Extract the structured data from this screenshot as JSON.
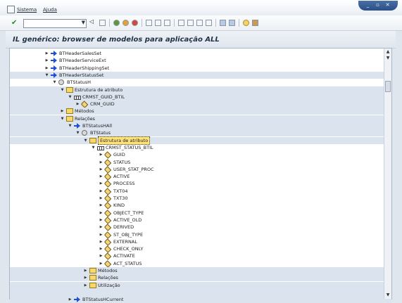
{
  "menu": {
    "items": [
      "Sistema",
      "Ajuda"
    ]
  },
  "toolbar": {
    "command_value": ""
  },
  "page": {
    "title": "IL genérico: browser de modelos para aplicação ALL"
  },
  "tree": {
    "rows": [
      {
        "label": "BTHeaderSalesSet",
        "depth": 0,
        "toggle": "collapsed",
        "icon": "arrow-icon",
        "band": false
      },
      {
        "label": "BTHeaderServiceExt",
        "depth": 0,
        "toggle": "collapsed",
        "icon": "arrow-icon",
        "band": false
      },
      {
        "label": "BTHeaderShippingSet",
        "depth": 0,
        "toggle": "collapsed",
        "icon": "arrow-icon",
        "band": false
      },
      {
        "label": "BTHeaderStatusSet",
        "depth": 0,
        "toggle": "expanded",
        "icon": "arrow-icon",
        "band": true
      },
      {
        "label": "BTStatusH",
        "depth": 1,
        "toggle": "expanded",
        "icon": "gear-icon",
        "band": false
      },
      {
        "label": "Estrutura de atributo",
        "depth": 2,
        "toggle": "expanded",
        "icon": "folder-icon",
        "band": true
      },
      {
        "label": "CRMST_GUID_BTIL",
        "depth": 3,
        "toggle": "expanded",
        "icon": "structure-icon",
        "band": true
      },
      {
        "label": "CRM_GUID",
        "depth": 4,
        "toggle": "collapsed",
        "icon": "tag-icon",
        "band": true
      },
      {
        "label": "Métodos",
        "depth": 2,
        "toggle": "collapsed",
        "icon": "folder-icon",
        "band": true
      },
      {
        "label": "Relações",
        "depth": 2,
        "toggle": "expanded",
        "icon": "folder-icon",
        "band": true
      },
      {
        "label": "BTStatusHAll",
        "depth": 3,
        "toggle": "expanded",
        "icon": "arrow-icon",
        "band": true
      },
      {
        "label": "BTStatus",
        "depth": 4,
        "toggle": "expanded",
        "icon": "gear-icon",
        "band": true
      },
      {
        "label": "Estrutura de atributo",
        "depth": 5,
        "toggle": "expanded",
        "icon": "folder-icon",
        "band": true,
        "selected": true
      },
      {
        "label": "CRMST_STATUS_BTIL",
        "depth": 6,
        "toggle": "expanded",
        "icon": "structure-icon",
        "band": false
      },
      {
        "label": "GUID",
        "depth": 7,
        "toggle": "collapsed",
        "icon": "tag-icon",
        "band": false
      },
      {
        "label": "STATUS",
        "depth": 7,
        "toggle": "collapsed",
        "icon": "tag-icon",
        "band": false
      },
      {
        "label": "USER_STAT_PROC",
        "depth": 7,
        "toggle": "collapsed",
        "icon": "tag-icon",
        "band": false
      },
      {
        "label": "ACTIVE",
        "depth": 7,
        "toggle": "collapsed",
        "icon": "tag-icon",
        "band": false
      },
      {
        "label": "PROCESS",
        "depth": 7,
        "toggle": "collapsed",
        "icon": "tag-icon",
        "band": false
      },
      {
        "label": "TXT04",
        "depth": 7,
        "toggle": "collapsed",
        "icon": "tag-icon",
        "band": false
      },
      {
        "label": "TXT30",
        "depth": 7,
        "toggle": "collapsed",
        "icon": "tag-icon",
        "band": false
      },
      {
        "label": "KIND",
        "depth": 7,
        "toggle": "collapsed",
        "icon": "tag-icon",
        "band": false
      },
      {
        "label": "OBJECT_TYPE",
        "depth": 7,
        "toggle": "collapsed",
        "icon": "tag-icon",
        "band": false
      },
      {
        "label": "ACTIVE_OLD",
        "depth": 7,
        "toggle": "collapsed",
        "icon": "tag-icon",
        "band": false
      },
      {
        "label": "DERIVED",
        "depth": 7,
        "toggle": "collapsed",
        "icon": "tag-icon",
        "band": false
      },
      {
        "label": "ST_OBJ_TYPE",
        "depth": 7,
        "toggle": "collapsed",
        "icon": "tag-icon",
        "band": false
      },
      {
        "label": "EXTERNAL",
        "depth": 7,
        "toggle": "collapsed",
        "icon": "tag-icon",
        "band": false
      },
      {
        "label": "CHECK_ONLY",
        "depth": 7,
        "toggle": "collapsed",
        "icon": "tag-icon",
        "band": false
      },
      {
        "label": "ACTIVATE",
        "depth": 7,
        "toggle": "collapsed",
        "icon": "tag-icon",
        "band": false
      },
      {
        "label": "ACT_STATUS",
        "depth": 7,
        "toggle": "collapsed",
        "icon": "tag-icon",
        "band": false
      },
      {
        "label": "Métodos",
        "depth": 5,
        "toggle": "collapsed",
        "icon": "folder-icon",
        "band": true
      },
      {
        "label": "Relações",
        "depth": 5,
        "toggle": "collapsed",
        "icon": "folder-icon",
        "band": true
      },
      {
        "label": "Utilização",
        "depth": 5,
        "toggle": "collapsed",
        "icon": "folder-icon",
        "band": true
      },
      {
        "label": "",
        "depth": 0,
        "toggle": "none",
        "icon": "none",
        "band": true
      },
      {
        "label": "BTStatusHCurrent",
        "depth": 3,
        "toggle": "collapsed",
        "icon": "arrow-icon",
        "band": true
      }
    ]
  }
}
